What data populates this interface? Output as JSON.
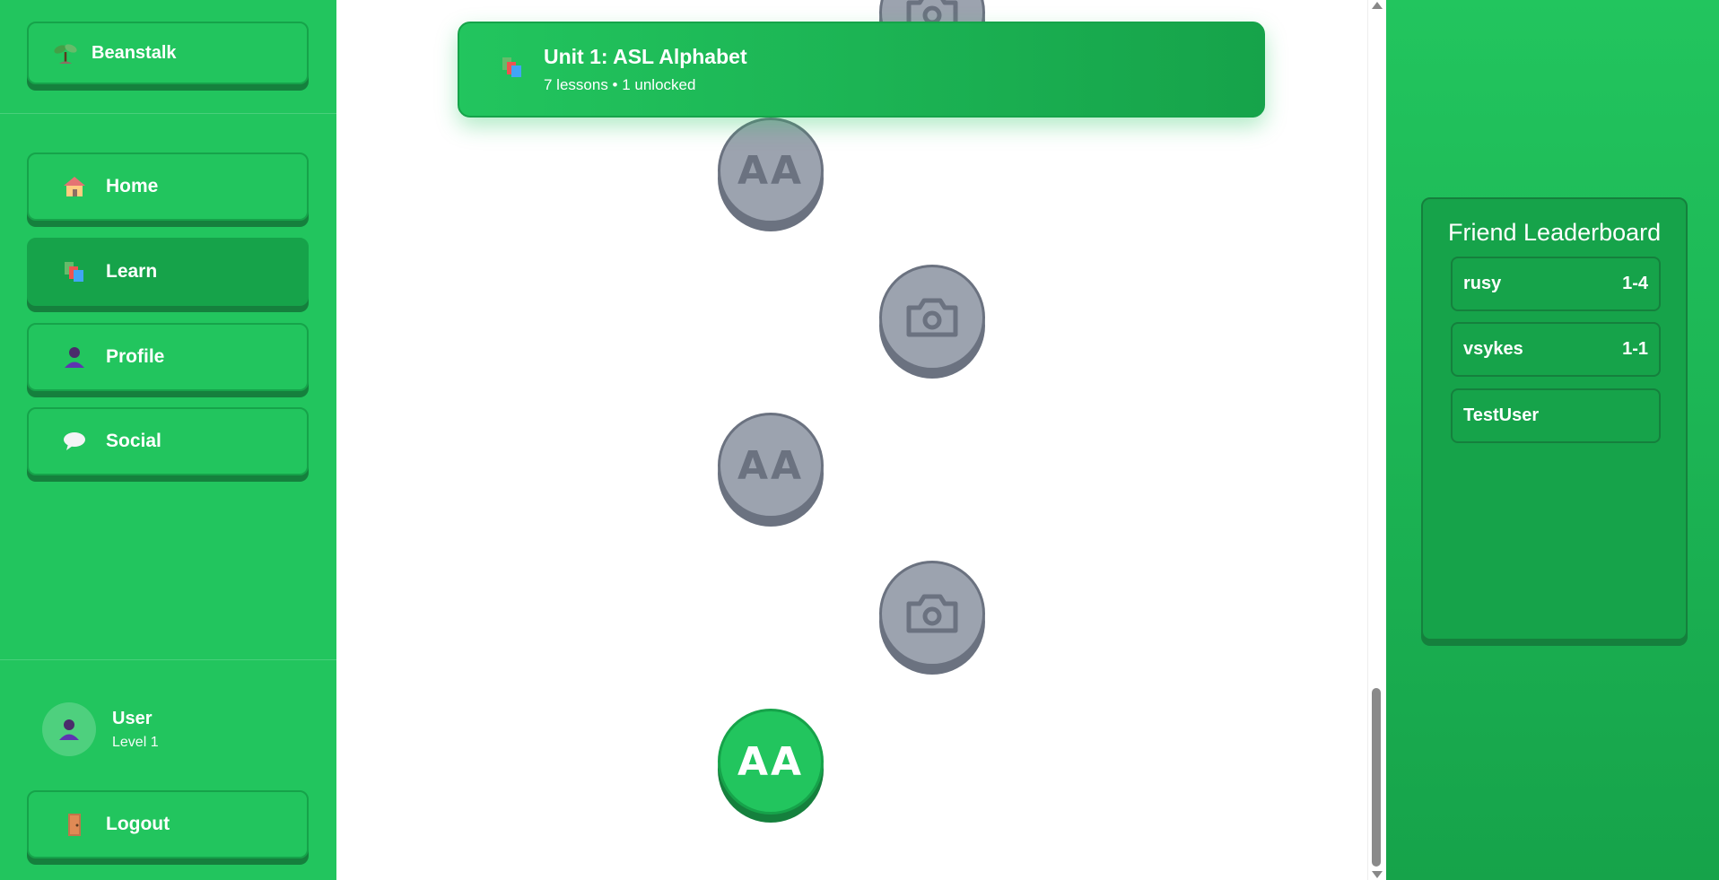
{
  "sidebar": {
    "brand": "Beanstalk",
    "nav": [
      {
        "label": "Home",
        "icon": "house-icon"
      },
      {
        "label": "Learn",
        "icon": "books-icon",
        "active": true
      },
      {
        "label": "Profile",
        "icon": "person-icon"
      },
      {
        "label": "Social",
        "icon": "speech-bubble-icon"
      }
    ],
    "user": {
      "name": "User",
      "level": "Level 1"
    },
    "logout": "Logout"
  },
  "main": {
    "unit": {
      "title": "Unit 1: ASL Alphabet",
      "subtitle": "7 lessons • 1 unlocked"
    },
    "nodes": [
      {
        "type": "camera",
        "state": "locked"
      },
      {
        "type": "alphabet",
        "label": "AA",
        "state": "locked"
      },
      {
        "type": "camera",
        "state": "locked"
      },
      {
        "type": "alphabet",
        "label": "AA",
        "state": "locked"
      },
      {
        "type": "camera",
        "state": "locked"
      },
      {
        "type": "alphabet",
        "label": "AA",
        "state": "unlocked"
      }
    ]
  },
  "leaderboard": {
    "title": "Friend Leaderboard",
    "entries": [
      {
        "name": "rusy",
        "score": "1-4"
      },
      {
        "name": "vsykes",
        "score": "1-1"
      },
      {
        "name": "TestUser",
        "score": ""
      }
    ]
  },
  "colors": {
    "green": "#22c55e",
    "dark_green": "#16a34a",
    "locked_gray": "#9ca3af"
  }
}
